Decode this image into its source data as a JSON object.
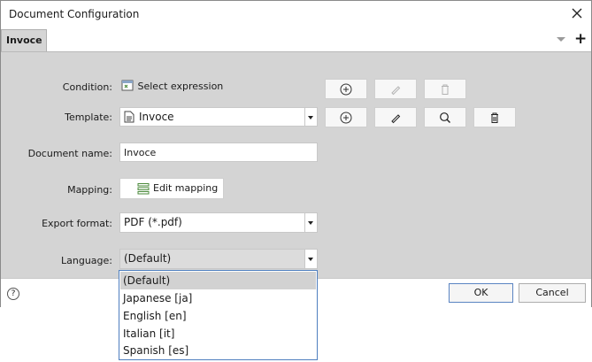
{
  "window": {
    "title": "Document Configuration"
  },
  "tabs": [
    {
      "label": "Invoce"
    }
  ],
  "form": {
    "condition": {
      "label": "Condition:",
      "link": "Select expression"
    },
    "template": {
      "label": "Template:",
      "value": "Invoce"
    },
    "document_name": {
      "label": "Document name:",
      "value": "Invoce"
    },
    "mapping": {
      "label": "Mapping:",
      "button": "Edit mapping"
    },
    "export_format": {
      "label": "Export format:",
      "value": "PDF (*.pdf)"
    },
    "language": {
      "label": "Language:",
      "value": "(Default)"
    }
  },
  "language_options": [
    "(Default)",
    "Japanese [ja]",
    "English [en]",
    "Italian [it]",
    "Spanish [es]"
  ],
  "footer": {
    "ok": "OK",
    "cancel": "Cancel",
    "help_glyph": "?"
  },
  "colors": {
    "accent": "#4f7fbf",
    "panel": "#d4d4d4",
    "icon_green": "#4a8a3a"
  }
}
